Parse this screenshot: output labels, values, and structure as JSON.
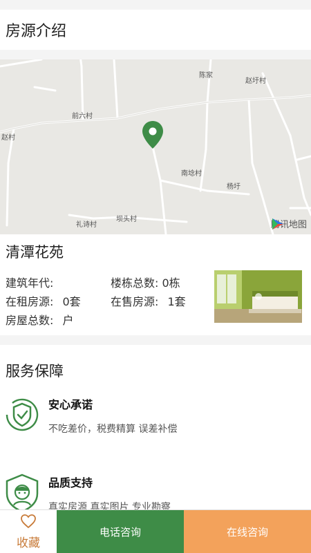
{
  "page": {
    "section_title": "房源介绍"
  },
  "map": {
    "labels": [
      "陈家",
      "赵圩村",
      "前六村",
      "赵村",
      "南埝村",
      "杨圩",
      "礼诗村",
      "坝头村"
    ],
    "logo_text": "腾讯地图",
    "pin_color": "#3e8c47"
  },
  "community": {
    "name": "清潭花苑",
    "build_year_label": "建筑年代:",
    "build_year_value": "",
    "buildings_label": "楼栋总数:",
    "buildings_value": "0栋",
    "rent_label": "在租房源:",
    "rent_value": "0套",
    "sale_label": "在售房源:",
    "sale_value": "1套",
    "households_label": "房屋总数:",
    "households_value": "户"
  },
  "service": {
    "title": "服务保障",
    "items": [
      {
        "title": "安心承诺",
        "desc": "不吃差价，税费精算 误差补偿",
        "icon": "shield-check-icon"
      },
      {
        "title": "品质支持",
        "desc": "真实房源 真实图片 专业勘察",
        "icon": "shield-person-icon"
      }
    ]
  },
  "bottom_bar": {
    "favorite_label": "收藏",
    "phone_label": "电话咨询",
    "online_label": "在线咨询",
    "colors": {
      "phone": "#3e8c47",
      "online": "#f3a25b",
      "favorite": "#c87b39"
    }
  }
}
